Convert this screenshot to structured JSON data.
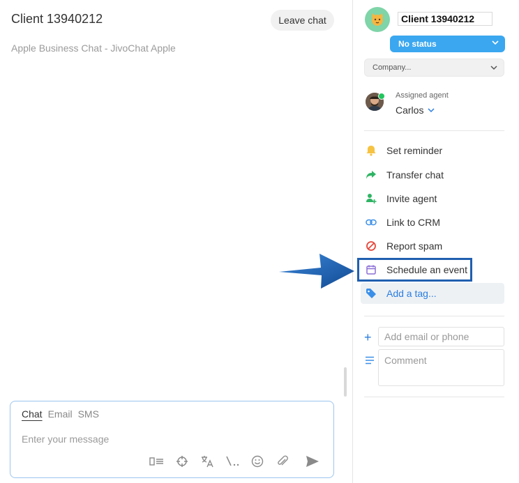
{
  "chat": {
    "title": "Client 13940212",
    "leave_label": "Leave chat",
    "source": "Apple Business Chat - JivoChat Apple"
  },
  "composer": {
    "tabs": [
      "Chat",
      "Email",
      "SMS"
    ],
    "active_tab": "Chat",
    "placeholder": "Enter your message",
    "tool_icons": [
      "quick-replies-icon",
      "target-icon",
      "translate-icon",
      "commands-icon",
      "emoji-icon",
      "attach-icon",
      "send-icon"
    ]
  },
  "client": {
    "name": "Client 13940212",
    "status": "No status",
    "company_placeholder": "Company..."
  },
  "agent": {
    "label": "Assigned agent",
    "name": "Carlos"
  },
  "actions": [
    {
      "label": "Set reminder",
      "icon": "bell-icon"
    },
    {
      "label": "Transfer chat",
      "icon": "transfer-arrow-icon"
    },
    {
      "label": "Invite agent",
      "icon": "add-person-icon"
    },
    {
      "label": "Link to CRM",
      "icon": "link-icon"
    },
    {
      "label": "Report spam",
      "icon": "block-icon"
    },
    {
      "label": "Schedule an event",
      "icon": "calendar-icon"
    },
    {
      "label": "Add a tag...",
      "icon": "tag-icon"
    }
  ],
  "contact": {
    "email_phone_placeholder": "Add email or phone",
    "comment_placeholder": "Comment"
  },
  "colors": {
    "status_button": "#3aa7f0",
    "highlight_box": "#1f5fb0",
    "annotation_arrow": "#1e63b8",
    "link_blue": "#2a7de1"
  }
}
